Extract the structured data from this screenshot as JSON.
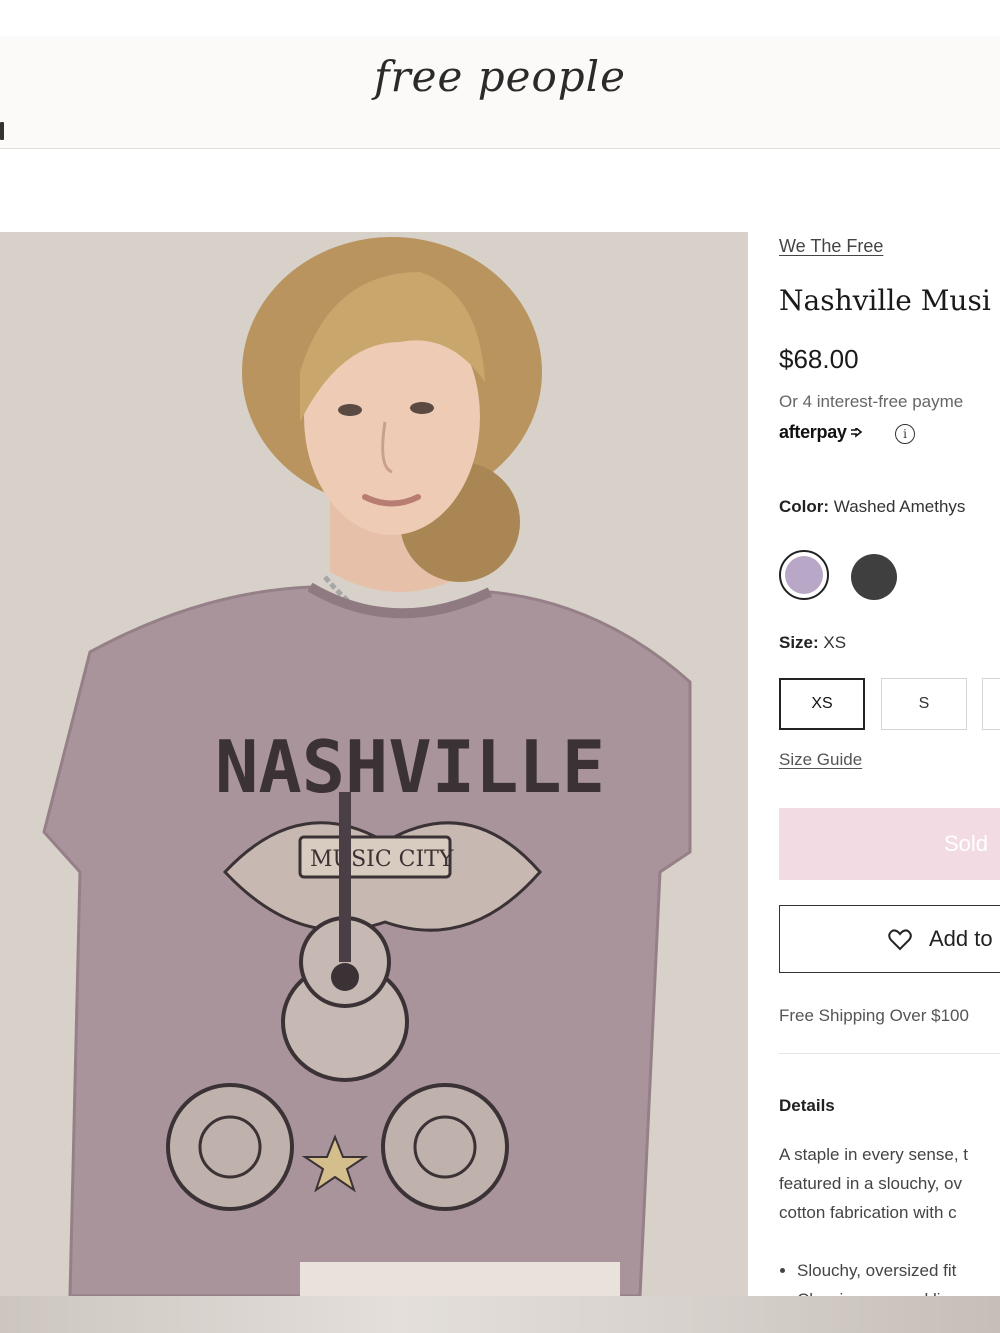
{
  "header": {
    "logo": "free people"
  },
  "product": {
    "brand": "We The Free",
    "title": "Nashville Musi",
    "price": "$68.00",
    "installments": "Or 4 interest-free payme",
    "afterpay_logo": "afterpay",
    "info_icon": "info-icon",
    "color_label": "Color:",
    "color_value": "Washed Amethys",
    "colors": [
      {
        "name": "Washed Amethyst",
        "hex": "#b9a7c8",
        "selected": true
      },
      {
        "name": "Black",
        "hex": "#3f3f3f",
        "selected": false
      }
    ],
    "size_label": "Size:",
    "size_value": "XS",
    "sizes": [
      "XS",
      "S"
    ],
    "size_guide": "Size Guide",
    "sold_button": "Sold",
    "wishlist_button": "Add to",
    "shipping": "Free Shipping Over $100",
    "details_heading": "Details",
    "details_lines": [
      "A staple in every sense, t",
      "featured in a slouchy, ov",
      "cotton fabrication with c"
    ],
    "bullets": [
      "Slouchy, oversized fit",
      "Classic crew neckline"
    ]
  },
  "tee_graphic": {
    "headline": "NASHVILLE",
    "banner": "MUSIC CITY"
  },
  "colors": {
    "header_bg": "#fbfaf8",
    "sold_bg": "#f2dbe3",
    "text_dark": "#1a1a1a",
    "tee": "#a8949a"
  }
}
